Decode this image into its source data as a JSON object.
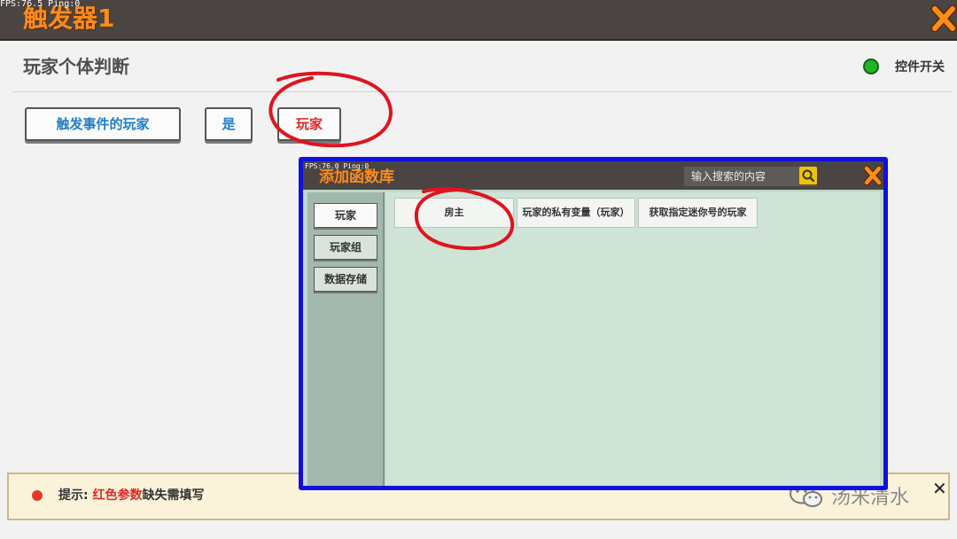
{
  "overlay": {
    "fps_main": "FPS:76.5  Ping:0",
    "fps_dialog": "FPS:76.0  Ping:0"
  },
  "window": {
    "title": "触发器1",
    "close_icon": "close-x-icon",
    "accent": "#ff8c1a"
  },
  "section": {
    "title": "玩家个体判断",
    "toggle_label": "控件开关",
    "toggle_color": "#22b522"
  },
  "condition": {
    "subject": "触发事件的玩家",
    "operator": "是",
    "value": "玩家"
  },
  "hint": {
    "prefix": "提示: ",
    "highlight": "红色参数",
    "suffix": "缺失需填写",
    "close_icon": "close-icon"
  },
  "watermark": {
    "text": "汤米清水",
    "icon": "wechat-icon"
  },
  "dialog": {
    "title": "添加函数库",
    "search_placeholder": "输入搜索的内容",
    "search_icon": "search-icon",
    "close_icon": "close-x-icon",
    "categories": [
      "玩家",
      "玩家组",
      "数据存储"
    ],
    "active_category": "玩家",
    "functions": [
      "房主",
      "玩家的私有变量（玩家）",
      "获取指定迷你号的玩家"
    ]
  }
}
